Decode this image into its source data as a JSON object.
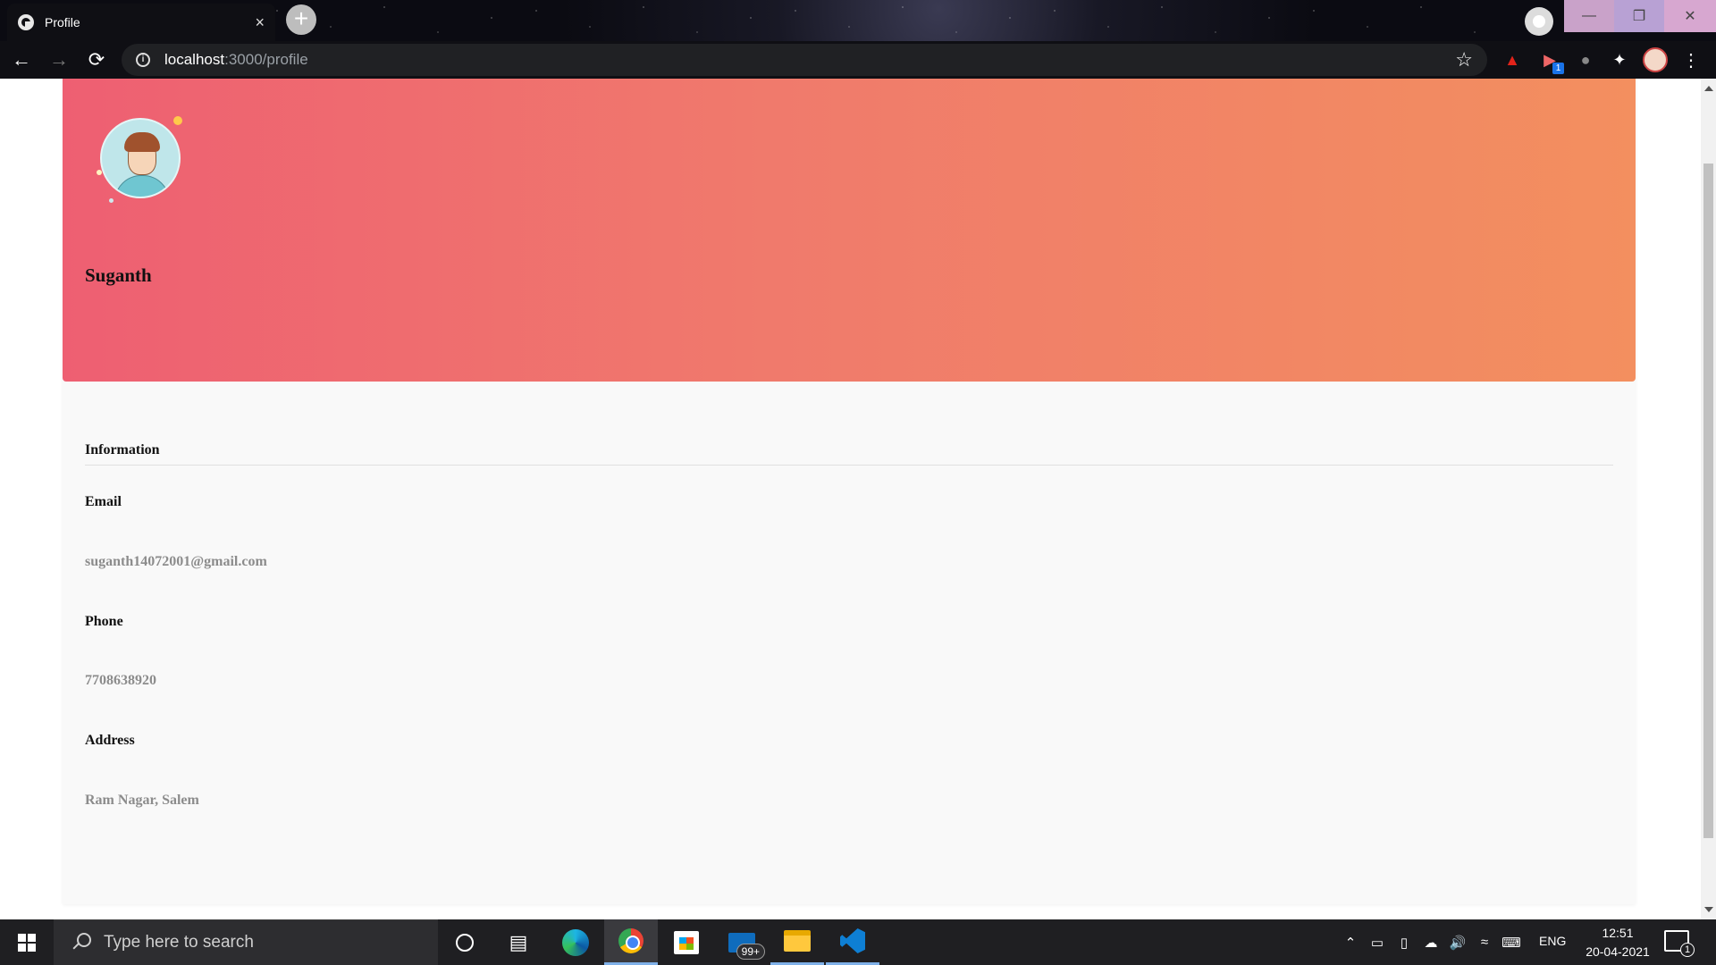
{
  "browser": {
    "tab_title": "Profile",
    "tab_close_icon": "×",
    "new_tab_icon": "+",
    "url_host": "localhost",
    "url_path": ":3000/profile",
    "extensions": [
      "pdf-icon",
      "cast-icon",
      "bulb-icon",
      "puzzle-icon",
      "avatar-icon"
    ],
    "cast_badge": "1"
  },
  "profile": {
    "name": "Suganth",
    "section_title": "Information",
    "fields": [
      {
        "label": "Email",
        "value": "suganth14072001@gmail.com"
      },
      {
        "label": "Phone",
        "value": "7708638920"
      },
      {
        "label": "Address",
        "value": "Ram Nagar, Salem"
      }
    ],
    "banner_colors": [
      "#ee5f72",
      "#f38f5f"
    ]
  },
  "taskbar": {
    "search_placeholder": "Type here to search",
    "mail_badge": "99+",
    "language": "ENG",
    "time": "12:51",
    "date": "20-04-2021",
    "notification_count": "1"
  }
}
